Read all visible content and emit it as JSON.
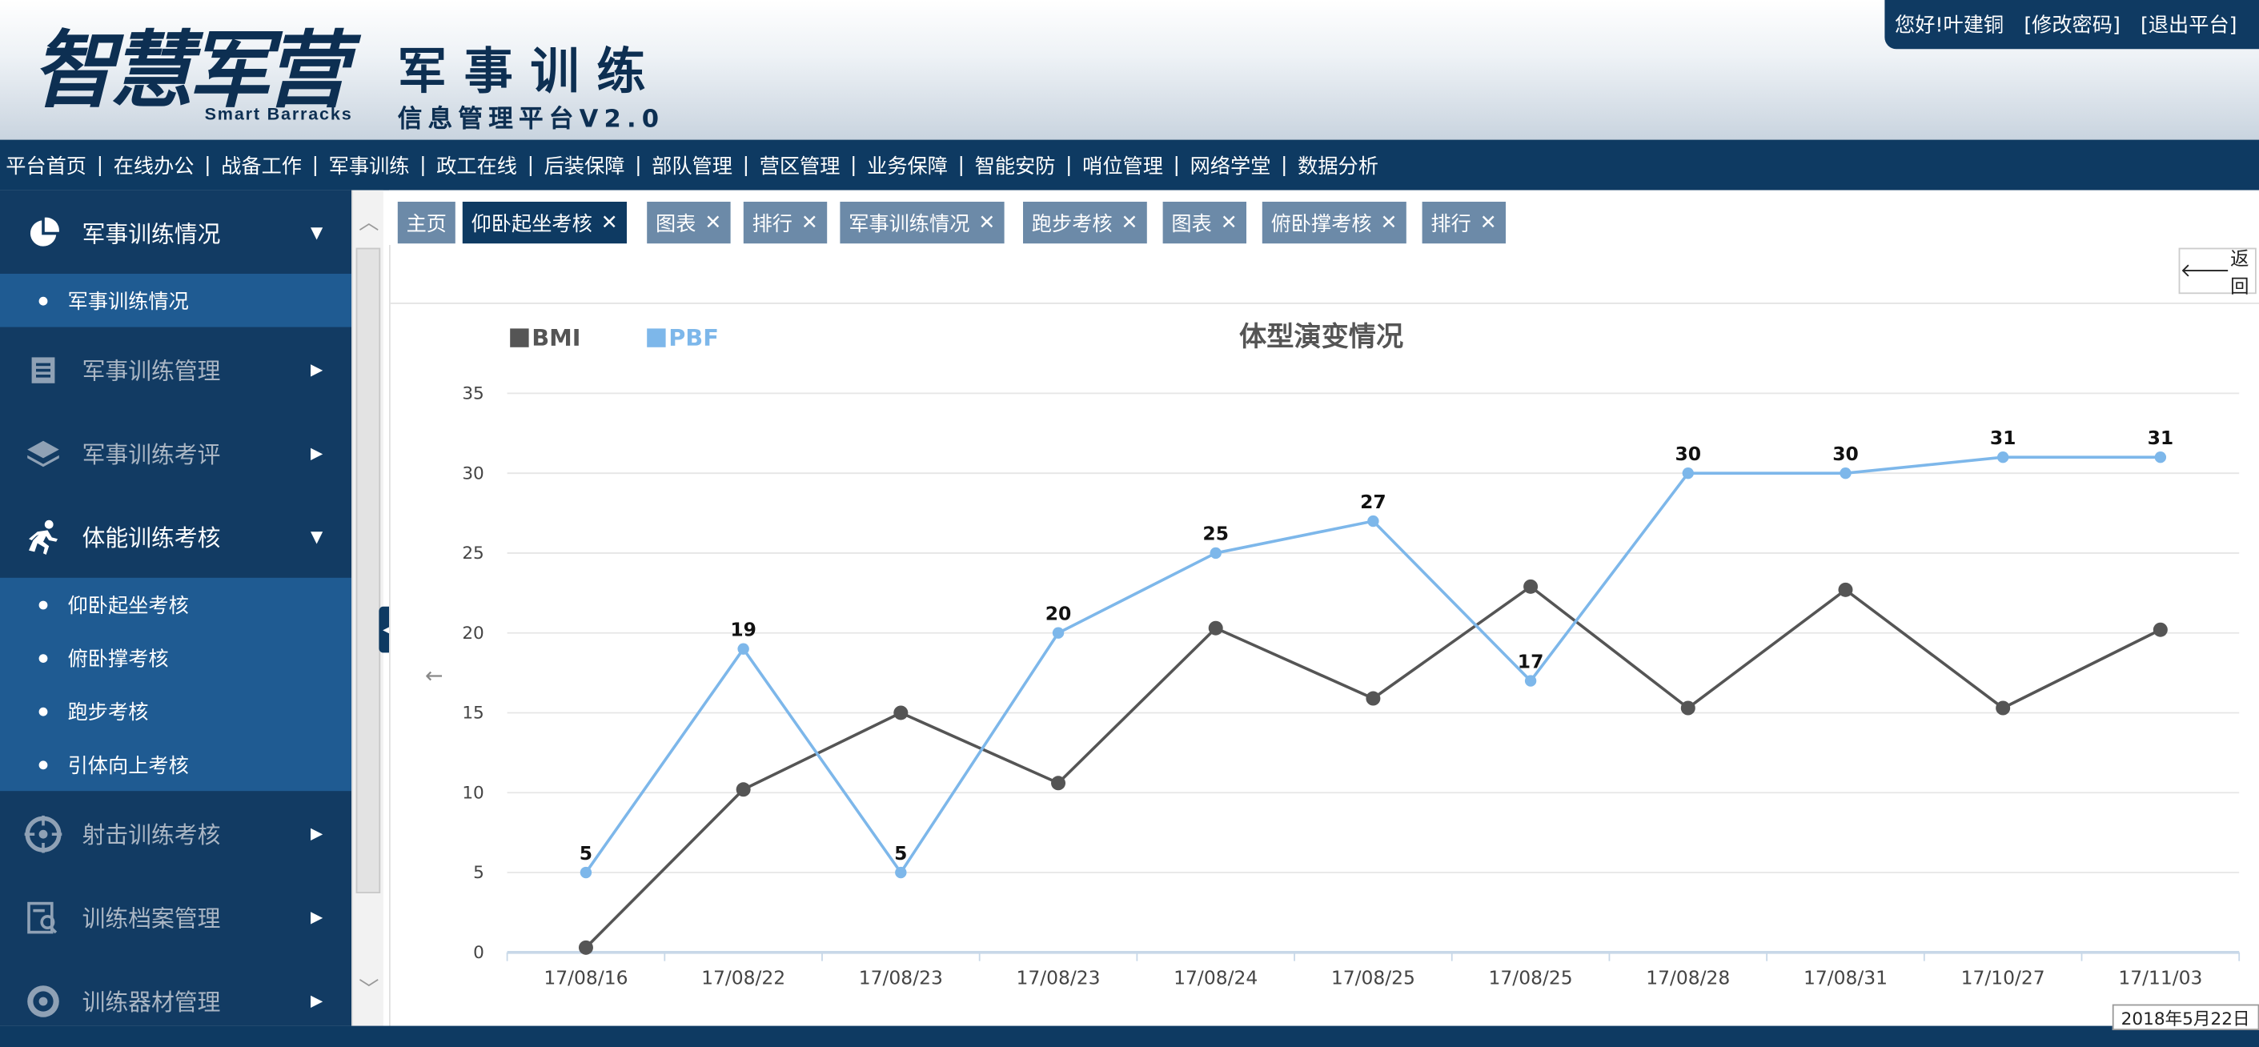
{
  "header": {
    "logo_text": "智慧军营",
    "logo_en": "Smart  Barracks",
    "title": "军事训练",
    "subtitle": "信息管理平台V2.0",
    "user_greeting": "您好!叶建铜",
    "change_password": "[修改密码]",
    "logout": "[退出平台]"
  },
  "nav": {
    "items": [
      "平台首页",
      "在线办公",
      "战备工作",
      "军事训练",
      "政工在线",
      "后装保障",
      "部队管理",
      "营区管理",
      "业务保障",
      "智能安防",
      "哨位管理",
      "网络学堂",
      "数据分析"
    ]
  },
  "sidebar": {
    "menu_training_status": "军事训练情况",
    "sub_training_status": "军事训练情况",
    "menu_training_manage": "军事训练管理",
    "menu_training_eval": "军事训练考评",
    "menu_fitness": "体能训练考核",
    "fitness_items": [
      "仰卧起坐考核",
      "俯卧撑考核",
      "跑步考核",
      "引体向上考核"
    ],
    "menu_shooting": "射击训练考核",
    "menu_archive": "训练档案管理",
    "menu_equipment": "训练器材管理"
  },
  "tabs": [
    {
      "label": "主页",
      "closable": false,
      "active": false
    },
    {
      "label": "仰卧起坐考核",
      "closable": true,
      "active": true
    },
    {
      "label": "图表",
      "closable": true,
      "active": false
    },
    {
      "label": "排行",
      "closable": true,
      "active": false
    },
    {
      "label": "军事训练情况",
      "closable": true,
      "active": false
    },
    {
      "label": "跑步考核",
      "closable": true,
      "active": false
    },
    {
      "label": "图表",
      "closable": true,
      "active": false
    },
    {
      "label": "俯卧撑考核",
      "closable": true,
      "active": false
    },
    {
      "label": "排行",
      "closable": true,
      "active": false
    }
  ],
  "back_button": "返回",
  "date_tooltip": "2018年5月22日",
  "colors": {
    "accent_dark": "#0e3a62",
    "bmi": "#555555",
    "pbf": "#7db7ea"
  },
  "chart_data": {
    "type": "line",
    "title": "体型演变情况",
    "x": [
      "17/08/16",
      "17/08/22",
      "17/08/23",
      "17/08/23",
      "17/08/24",
      "17/08/25",
      "17/08/25",
      "17/08/28",
      "17/08/31",
      "17/10/27",
      "17/11/03"
    ],
    "series": [
      {
        "name": "BMI",
        "color": "#555555",
        "values": [
          0.3,
          10.2,
          15,
          10.6,
          20.3,
          15.9,
          22.9,
          15.3,
          22.7,
          15.3,
          20.2
        ],
        "labels": false
      },
      {
        "name": "PBF",
        "color": "#7db7ea",
        "values": [
          5,
          19,
          5,
          20,
          25,
          27,
          17,
          30,
          30,
          31,
          31
        ],
        "labels": true
      }
    ],
    "ylim": [
      0,
      35
    ],
    "yticks": [
      0,
      5,
      10,
      15,
      20,
      25,
      30,
      35
    ],
    "grid": true,
    "legend": "top-left"
  }
}
